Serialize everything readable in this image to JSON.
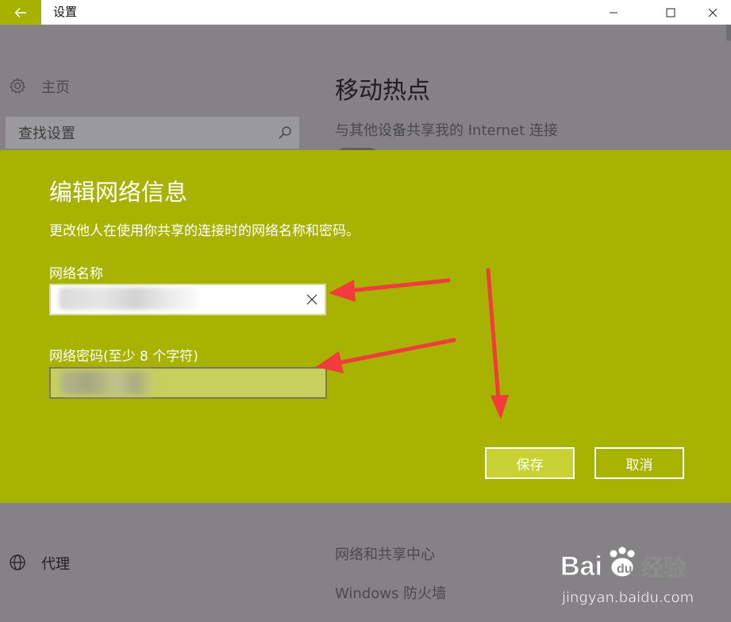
{
  "window": {
    "title": "设置",
    "back_icon": "arrow-left-icon",
    "controls": [
      "minimize-icon",
      "maximize-icon",
      "close-icon"
    ]
  },
  "sidebar": {
    "home_label": "主页",
    "search_placeholder": "查找设置",
    "proxy_label": "代理"
  },
  "main": {
    "title": "移动热点",
    "share_label": "与其他设备共享我的 Internet 连接",
    "toggle_state": "开",
    "links": {
      "network_center": "网络和共享中心",
      "firewall": "Windows 防火墙"
    }
  },
  "dialog": {
    "title": "编辑网络信息",
    "description": "更改他人在使用你共享的连接时的网络名称和密码。",
    "name_label": "网络名称",
    "name_value": "",
    "password_label": "网络密码(至少 8 个字符)",
    "password_value": "",
    "save_label": "保存",
    "cancel_label": "取消"
  },
  "colors": {
    "accent": "#a8b200",
    "dialog_bg": "#a8b200",
    "save_button": "#c9d234",
    "annotation_arrow": "#f23c3c"
  },
  "watermark": {
    "brand": "Bai",
    "brand_cn": "经验",
    "url": "jingyan.baidu.com"
  }
}
